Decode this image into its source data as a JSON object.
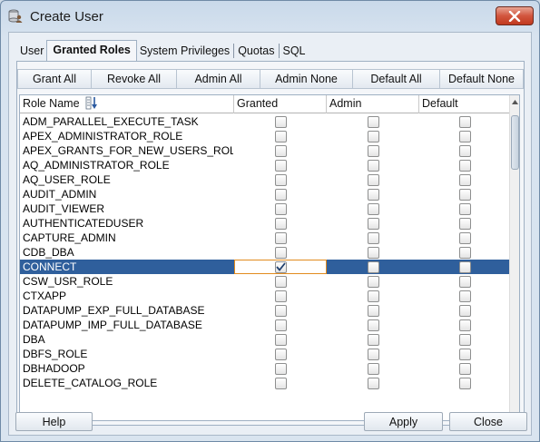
{
  "window": {
    "title": "Create User"
  },
  "tabs": [
    {
      "label": "User",
      "active": false
    },
    {
      "label": "Granted Roles",
      "active": true
    },
    {
      "label": "System Privileges",
      "active": false
    },
    {
      "label": "Quotas",
      "active": false
    },
    {
      "label": "SQL",
      "active": false
    }
  ],
  "toolbar": {
    "grant_all": "Grant All",
    "revoke_all": "Revoke All",
    "admin_all": "Admin All",
    "admin_none": "Admin None",
    "default_all": "Default All",
    "default_none": "Default None"
  },
  "table": {
    "columns": [
      "Role Name",
      "Granted",
      "Admin",
      "Default"
    ],
    "rows": [
      {
        "name": "ADM_PARALLEL_EXECUTE_TASK",
        "granted": false,
        "admin": false,
        "default": false
      },
      {
        "name": "APEX_ADMINISTRATOR_ROLE",
        "granted": false,
        "admin": false,
        "default": false
      },
      {
        "name": "APEX_GRANTS_FOR_NEW_USERS_ROLE",
        "granted": false,
        "admin": false,
        "default": false
      },
      {
        "name": "AQ_ADMINISTRATOR_ROLE",
        "granted": false,
        "admin": false,
        "default": false
      },
      {
        "name": "AQ_USER_ROLE",
        "granted": false,
        "admin": false,
        "default": false
      },
      {
        "name": "AUDIT_ADMIN",
        "granted": false,
        "admin": false,
        "default": false
      },
      {
        "name": "AUDIT_VIEWER",
        "granted": false,
        "admin": false,
        "default": false
      },
      {
        "name": "AUTHENTICATEDUSER",
        "granted": false,
        "admin": false,
        "default": false
      },
      {
        "name": "CAPTURE_ADMIN",
        "granted": false,
        "admin": false,
        "default": false
      },
      {
        "name": "CDB_DBA",
        "granted": false,
        "admin": false,
        "default": false
      },
      {
        "name": "CONNECT",
        "granted": true,
        "admin": false,
        "default": false,
        "selected": true
      },
      {
        "name": "CSW_USR_ROLE",
        "granted": false,
        "admin": false,
        "default": false
      },
      {
        "name": "CTXAPP",
        "granted": false,
        "admin": false,
        "default": false
      },
      {
        "name": "DATAPUMP_EXP_FULL_DATABASE",
        "granted": false,
        "admin": false,
        "default": false
      },
      {
        "name": "DATAPUMP_IMP_FULL_DATABASE",
        "granted": false,
        "admin": false,
        "default": false
      },
      {
        "name": "DBA",
        "granted": false,
        "admin": false,
        "default": false
      },
      {
        "name": "DBFS_ROLE",
        "granted": false,
        "admin": false,
        "default": false
      },
      {
        "name": "DBHADOOP",
        "granted": false,
        "admin": false,
        "default": false
      },
      {
        "name": "DELETE_CATALOG_ROLE",
        "granted": false,
        "admin": false,
        "default": false
      }
    ]
  },
  "buttons": {
    "help": "Help",
    "apply": "Apply",
    "close": "Close"
  },
  "colors": {
    "selection": "#2f5f9c",
    "focus_border": "#e28b1e",
    "close_button": "#c9452b"
  },
  "icons": {
    "app": "database-user-icon",
    "sort": "sort-order-icon",
    "close": "close-icon"
  }
}
